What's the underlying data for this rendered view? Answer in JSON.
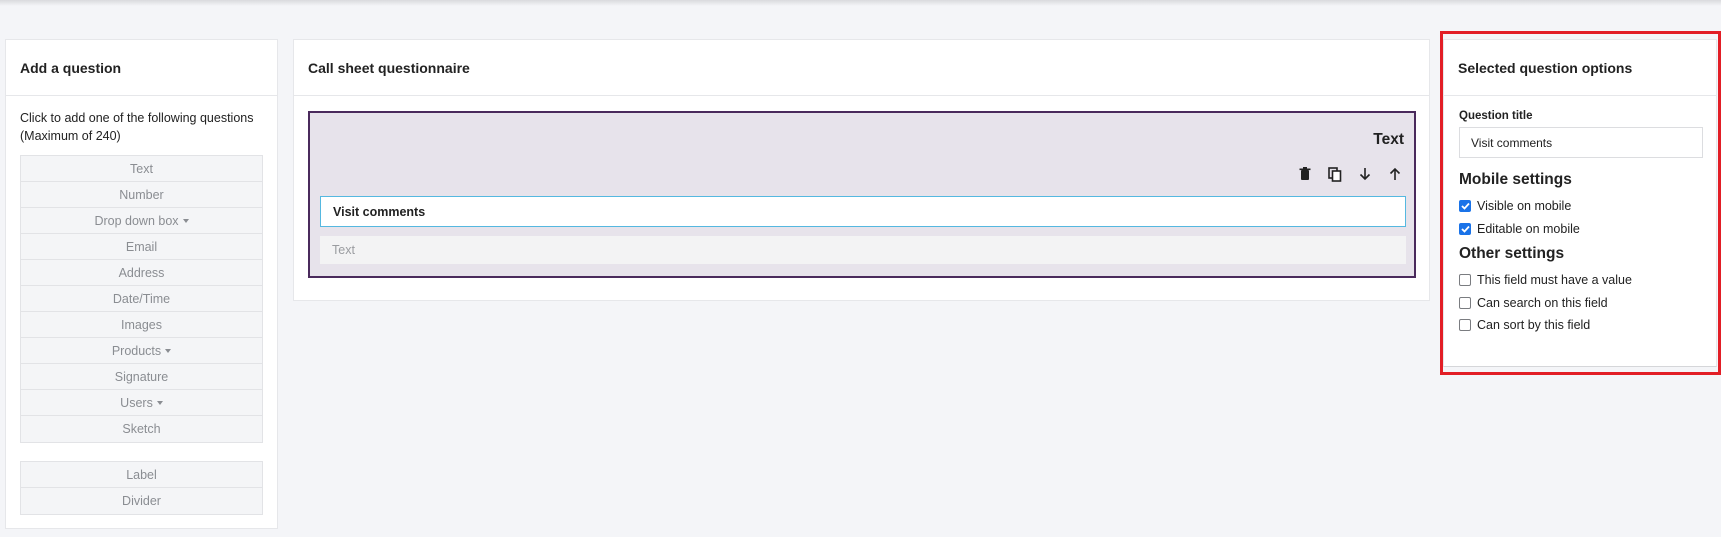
{
  "left": {
    "title": "Add a question",
    "intro": "Click to add one of the following questions (Maximum of 240)",
    "question_types": [
      {
        "label": "Text",
        "dropdown": false
      },
      {
        "label": "Number",
        "dropdown": false
      },
      {
        "label": "Drop down box",
        "dropdown": true
      },
      {
        "label": "Email",
        "dropdown": false
      },
      {
        "label": "Address",
        "dropdown": false
      },
      {
        "label": "Date/Time",
        "dropdown": false
      },
      {
        "label": "Images",
        "dropdown": false
      },
      {
        "label": "Products",
        "dropdown": true
      },
      {
        "label": "Signature",
        "dropdown": false
      },
      {
        "label": "Users",
        "dropdown": true
      },
      {
        "label": "Sketch",
        "dropdown": false
      }
    ],
    "layout_types": [
      {
        "label": "Label"
      },
      {
        "label": "Divider"
      }
    ]
  },
  "center": {
    "title": "Call sheet questionnaire",
    "question": {
      "type": "Text",
      "title": "Visit comments",
      "answer_placeholder": "Text",
      "tools": [
        "trash-icon",
        "copy-icon",
        "arrow-down-icon",
        "arrow-up-icon"
      ]
    }
  },
  "right": {
    "title": "Selected question options",
    "question_title_label": "Question title",
    "question_title_value": "Visit comments",
    "mobile_heading": "Mobile settings",
    "mobile_options": [
      {
        "label": "Visible on mobile",
        "checked": true
      },
      {
        "label": "Editable on mobile",
        "checked": true
      }
    ],
    "other_heading": "Other settings",
    "other_options": [
      {
        "label": "This field must have a value",
        "checked": false
      },
      {
        "label": "Can search on this field",
        "checked": false
      },
      {
        "label": "Can sort by this field",
        "checked": false
      }
    ]
  },
  "colors": {
    "highlight": "#e21e26",
    "question_border": "#4a2a5c",
    "question_bg": "#e7e3eb",
    "checkbox_checked": "#1a73e8",
    "input_focus": "#55b8e0"
  }
}
